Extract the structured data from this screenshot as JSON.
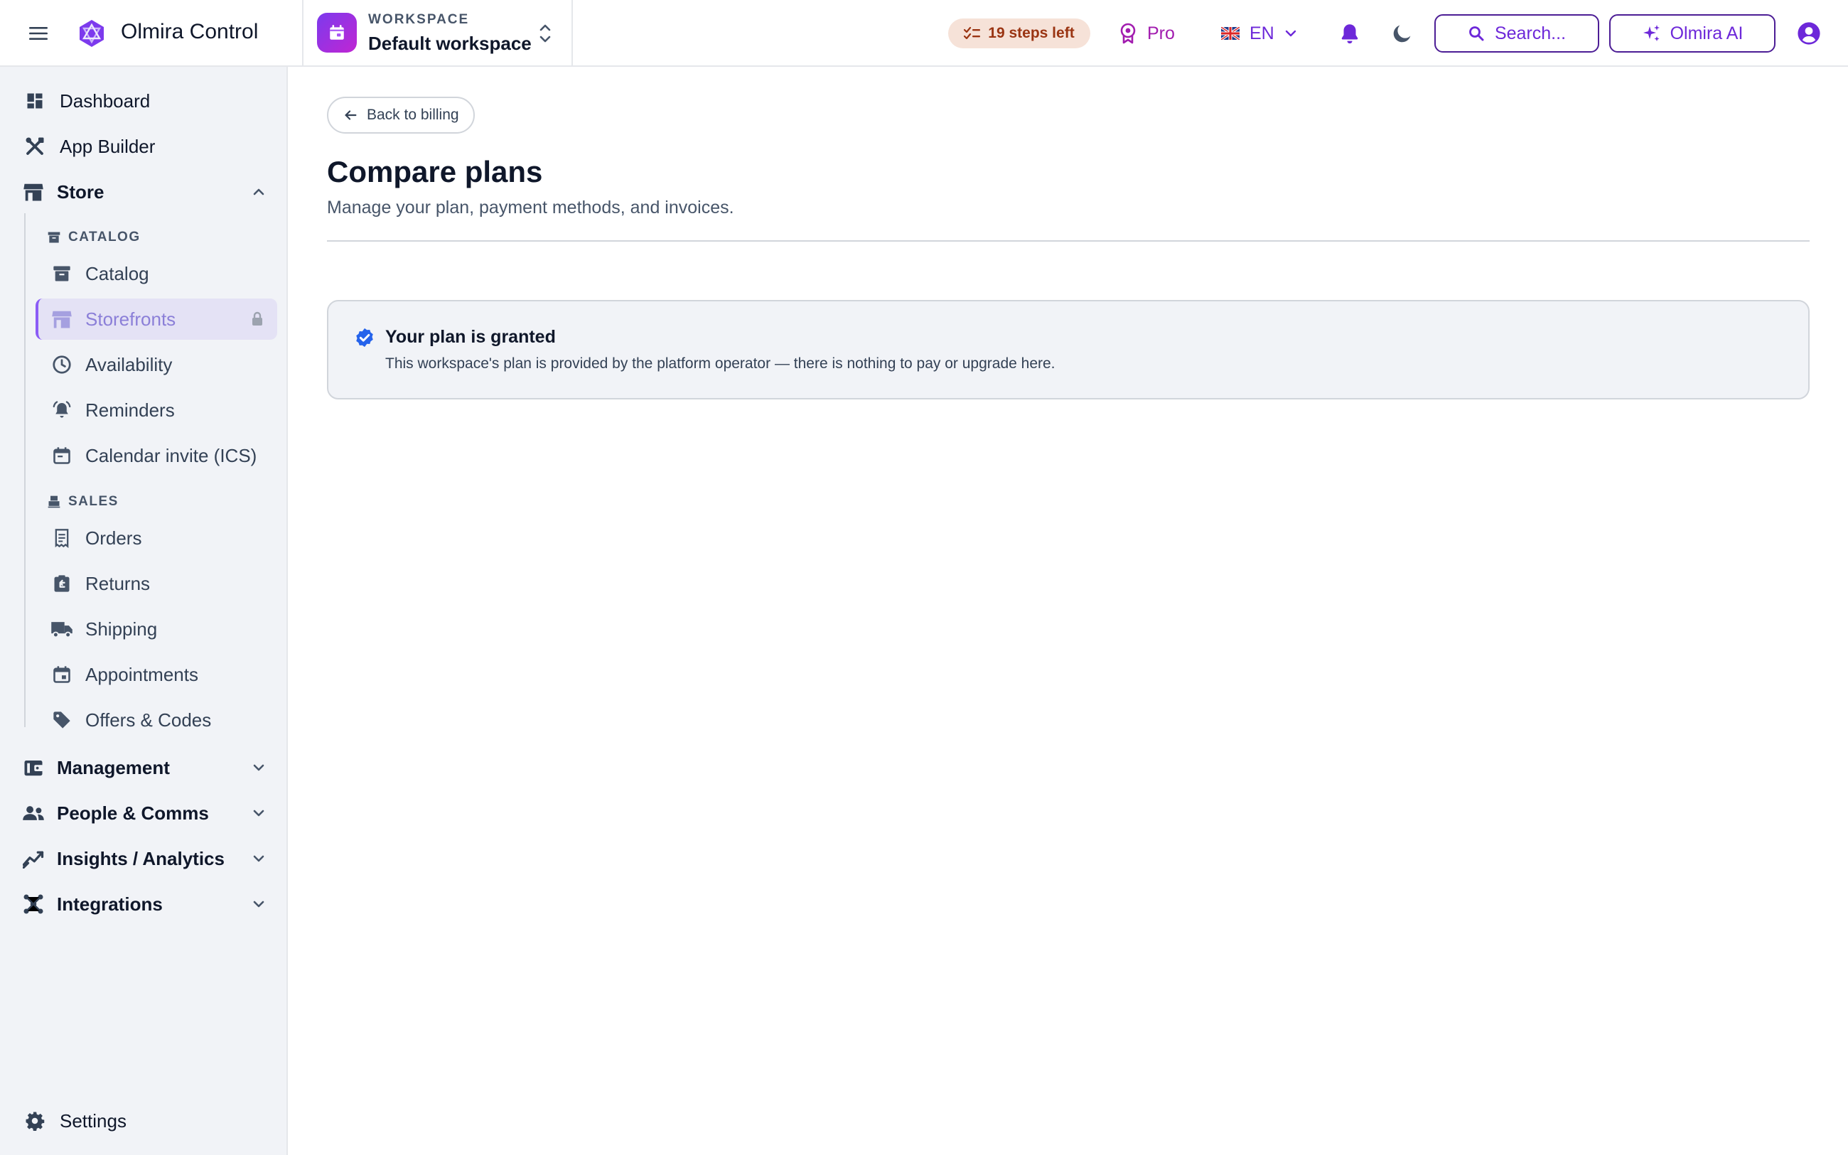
{
  "app": {
    "name": "Olmira Control"
  },
  "workspace": {
    "kicker": "WORKSPACE",
    "name": "Default workspace"
  },
  "header": {
    "steps_label": "19 steps left",
    "plan_label": "Pro",
    "language_label": "EN",
    "search_label": "Search...",
    "ai_label": "Olmira AI"
  },
  "sidebar": {
    "top_items": [
      {
        "label": "Dashboard",
        "icon": "dashboard-icon"
      },
      {
        "label": "App Builder",
        "icon": "tools-icon"
      }
    ],
    "store_group": {
      "label": "Store",
      "expanded": true,
      "sections": [
        {
          "title": "CATALOG",
          "items": [
            {
              "label": "Catalog",
              "icon": "archive-icon"
            },
            {
              "label": "Storefronts",
              "icon": "storefront-icon",
              "active": true,
              "locked": true
            },
            {
              "label": "Availability",
              "icon": "clock-icon"
            },
            {
              "label": "Reminders",
              "icon": "bell-ring-icon"
            },
            {
              "label": "Calendar invite (ICS)",
              "icon": "calendar-icon"
            }
          ]
        },
        {
          "title": "SALES",
          "items": [
            {
              "label": "Orders",
              "icon": "receipt-icon"
            },
            {
              "label": "Returns",
              "icon": "return-box-icon"
            },
            {
              "label": "Shipping",
              "icon": "truck-icon"
            },
            {
              "label": "Appointments",
              "icon": "calendar-event-icon"
            },
            {
              "label": "Offers & Codes",
              "icon": "tag-icon"
            }
          ]
        }
      ]
    },
    "groups": [
      {
        "label": "Management",
        "icon": "wallet-icon"
      },
      {
        "label": "People & Comms",
        "icon": "people-icon"
      },
      {
        "label": "Insights / Analytics",
        "icon": "analytics-icon"
      },
      {
        "label": "Integrations",
        "icon": "hub-icon"
      }
    ],
    "footer": {
      "label": "Settings",
      "icon": "gear-icon"
    }
  },
  "main": {
    "back_label": "Back to billing",
    "title": "Compare plans",
    "subtitle": "Manage your plan, payment methods, and invoices.",
    "notice": {
      "title": "Your plan is granted",
      "text": "This workspace's plan is provided by the platform operator — there is nothing to pay or upgrade here."
    }
  },
  "colors": {
    "accent": "#6d28d9",
    "brand_gradient_start": "#7c3aed",
    "brand_gradient_end": "#c026d3",
    "steps_pill_bg": "#f6e2d8",
    "steps_pill_text": "#9a3412",
    "pro_text": "#a21caf",
    "active_nav_bg": "#e4e2f5",
    "notice_check": "#2563eb"
  }
}
